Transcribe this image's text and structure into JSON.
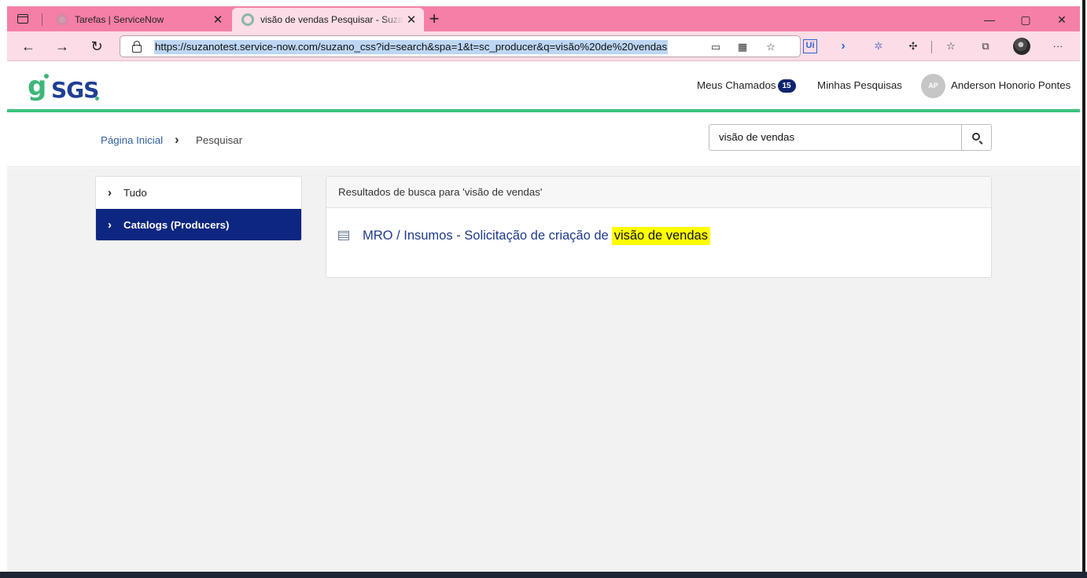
{
  "browser": {
    "tabs": [
      {
        "title": "Tarefas | ServiceNow",
        "close": "✕",
        "active": false
      },
      {
        "title": "visão de vendas Pesquisar - Suzano",
        "close": "✕",
        "active": true
      }
    ],
    "new_tab": "+",
    "window_controls": {
      "minimize": "—",
      "maximize": "▢",
      "close": "✕"
    },
    "nav": {
      "back": "←",
      "forward": "→",
      "reload": "↻"
    },
    "url": "https://suzanotest.service-now.com/suzano_css?id=search&spa=1&t=sc_producer&q=visão%20de%20vendas",
    "more": "···"
  },
  "header": {
    "logo_text": "SGS",
    "meus_chamados": "Meus Chamados",
    "chamados_count": "15",
    "minhas_pesquisas": "Minhas Pesquisas",
    "avatar_initials": "AP",
    "user_name": "Anderson Honorio Pontes"
  },
  "breadcrumb": {
    "home": "Página Inicial",
    "separator": "›",
    "current": "Pesquisar"
  },
  "search": {
    "value": "visão de vendas"
  },
  "filters": [
    {
      "label": "Tudo",
      "selected": false
    },
    {
      "label": "Catalogs (Producers)",
      "selected": true
    }
  ],
  "results": {
    "heading": "Resultados de busca para 'visão de vendas'",
    "items": [
      {
        "title_prefix": "MRO / Insumos - Solicitação de criação de",
        "highlight": "visão de vendas"
      }
    ]
  },
  "colors": {
    "tabbar": "#f57fa7",
    "accent_green": "#3bc47e",
    "brand_navy": "#0d2680",
    "highlight": "#ffff00"
  }
}
